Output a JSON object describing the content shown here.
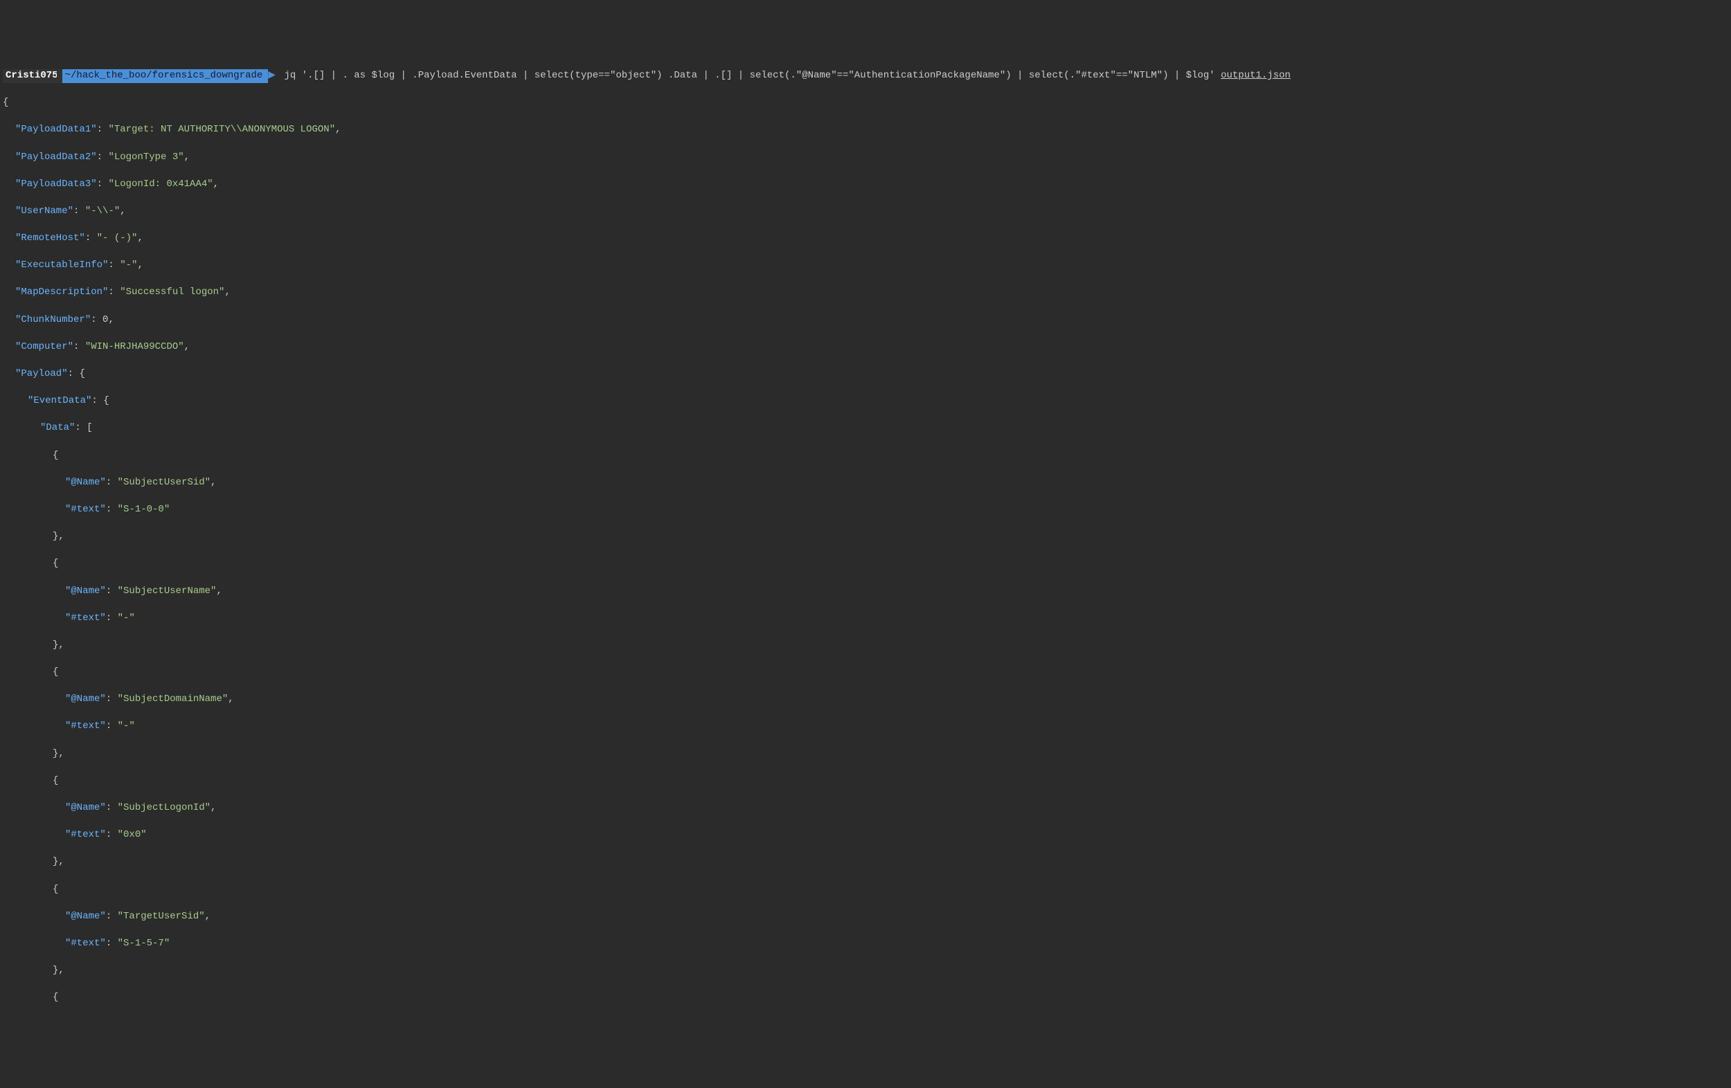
{
  "prompt": {
    "user": "Cristi075",
    "path": "~/hack_the_boo/forensics_downgrade",
    "command": "jq '.[] | . as $log | .Payload.EventData | select(type==\"object\") .Data | .[] | select(.\"@Name\"==\"AuthenticationPackageName\") | select(.\"#text\"==\"NTLM\") | $log'",
    "filename": "output1.json"
  },
  "json": {
    "brace_open": "{",
    "brace_close": "}",
    "bracket_open": "[",
    "bracket_close": "]",
    "colon": ": ",
    "comma": ",",
    "keys": {
      "PayloadData1": "\"PayloadData1\"",
      "PayloadData2": "\"PayloadData2\"",
      "PayloadData3": "\"PayloadData3\"",
      "UserName": "\"UserName\"",
      "RemoteHost": "\"RemoteHost\"",
      "ExecutableInfo": "\"ExecutableInfo\"",
      "MapDescription": "\"MapDescription\"",
      "ChunkNumber": "\"ChunkNumber\"",
      "Computer": "\"Computer\"",
      "Payload": "\"Payload\"",
      "EventData": "\"EventData\"",
      "Data": "\"Data\"",
      "atName": "\"@Name\"",
      "hashText": "\"#text\""
    },
    "values": {
      "PayloadData1": "\"Target: NT AUTHORITY\\\\ANONYMOUS LOGON\"",
      "PayloadData2": "\"LogonType 3\"",
      "PayloadData3": "\"LogonId: 0x41AA4\"",
      "UserName": "\"-\\\\-\"",
      "RemoteHost": "\"- (-)\"",
      "ExecutableInfo": "\"-\"",
      "MapDescription": "\"Successful logon\"",
      "ChunkNumber": "0",
      "Computer": "\"WIN-HRJHA99CCDO\""
    },
    "data_array": [
      {
        "name": "\"SubjectUserSid\"",
        "text": "\"S-1-0-0\""
      },
      {
        "name": "\"SubjectUserName\"",
        "text": "\"-\""
      },
      {
        "name": "\"SubjectDomainName\"",
        "text": "\"-\""
      },
      {
        "name": "\"SubjectLogonId\"",
        "text": "\"0x0\""
      },
      {
        "name": "\"TargetUserSid\"",
        "text": "\"S-1-5-7\""
      }
    ]
  }
}
